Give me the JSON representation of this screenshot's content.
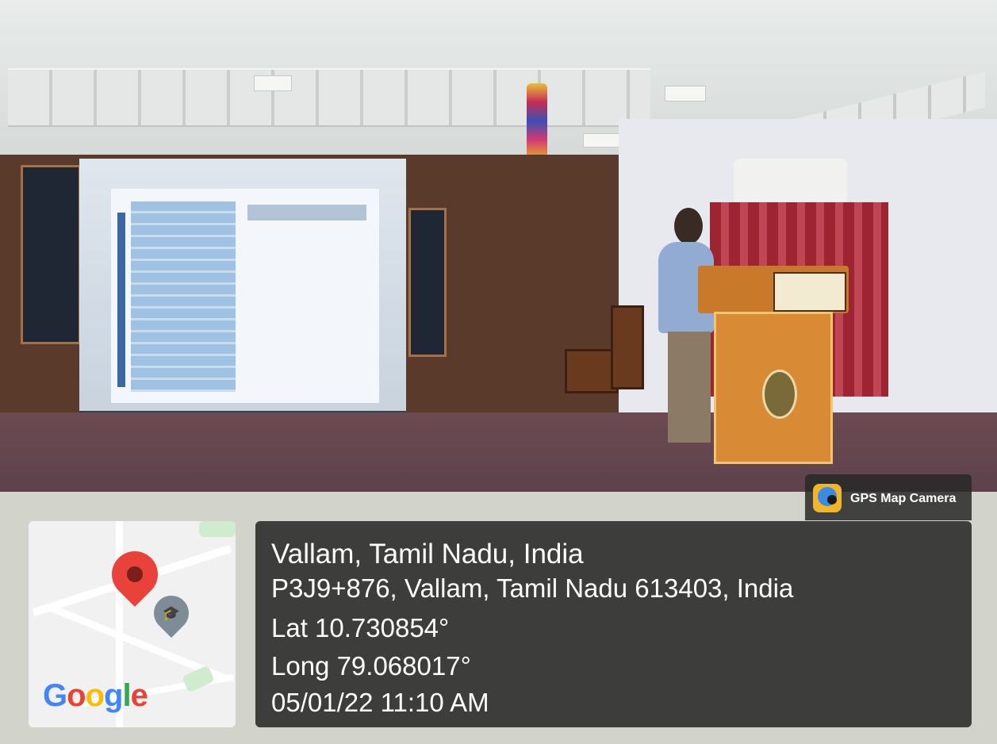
{
  "overlay": {
    "location_title": "Vallam, Tamil Nadu, India",
    "address": "P3J9+876, Vallam, Tamil Nadu 613403, India",
    "latitude": "Lat 10.730854°",
    "longitude": "Long 79.068017°",
    "datetime": "05/01/22 11:10 AM"
  },
  "badge": {
    "app_name": "GPS Map Camera",
    "icon": "gps-map-camera-icon"
  },
  "map": {
    "brand": [
      "G",
      "o",
      "o",
      "g",
      "l",
      "e"
    ],
    "brand_colors": [
      "#4285F4",
      "#EA4335",
      "#FBBC05",
      "#4285F4",
      "#34A853",
      "#EA4335"
    ],
    "pin_color": "#e8423a",
    "icons": [
      "map-pin-icon",
      "school-icon"
    ]
  },
  "scene": {
    "description_colors": {
      "wall": "#5a3a2a",
      "curtain": "#9c2531",
      "stage": "#6c4a52",
      "podium": "#d98a35"
    }
  }
}
